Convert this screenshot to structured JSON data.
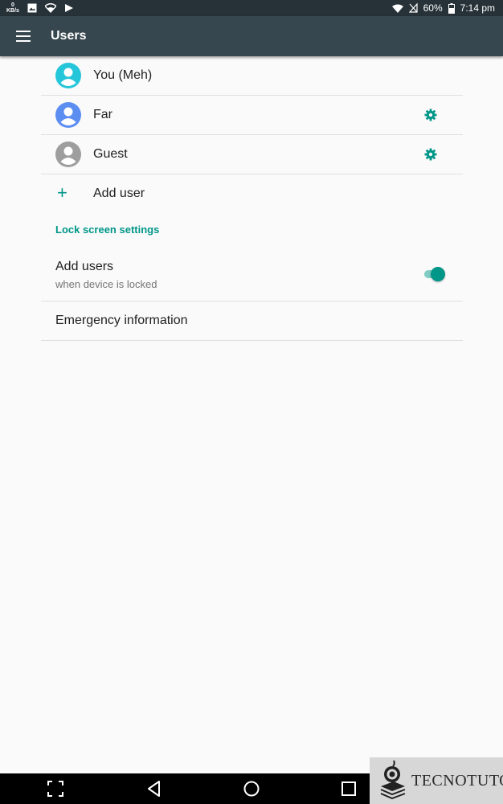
{
  "status_bar": {
    "net_speed_value": "0",
    "net_speed_unit": "KB/s",
    "battery": "60%",
    "time": "7:14 pm"
  },
  "toolbar": {
    "title": "Users"
  },
  "users": [
    {
      "label": "You (Meh)",
      "avatar_color": "#26c6da",
      "icon": "person-avatar-icon",
      "has_settings": false
    },
    {
      "label": "Far",
      "avatar_color": "#5c8ef2",
      "icon": "person-avatar-icon",
      "has_settings": true
    },
    {
      "label": "Guest",
      "avatar_color": "#9e9e9e",
      "icon": "person-avatar-icon",
      "has_settings": true
    }
  ],
  "add_user": {
    "label": "Add user",
    "icon": "plus-icon"
  },
  "lock_screen": {
    "header": "Lock screen settings",
    "add_users_title": "Add users",
    "add_users_subtitle": "when device is locked",
    "add_users_enabled": true
  },
  "emergency": {
    "label": "Emergency information"
  },
  "colors": {
    "accent": "#009688",
    "toolbar": "#37474f",
    "statusbar": "#263238"
  },
  "watermark": {
    "text": "TECNOTUTO"
  }
}
